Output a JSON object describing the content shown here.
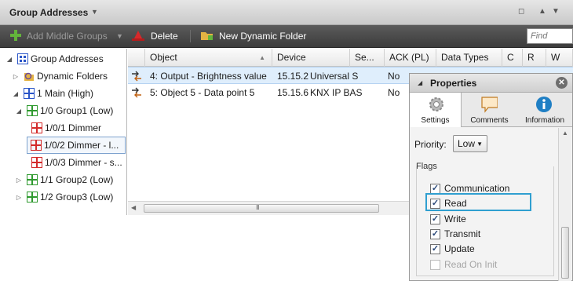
{
  "window": {
    "title": "Group Addresses",
    "title_arrow": "▼",
    "restore_glyph": "◻",
    "up_glyph": "▲",
    "down_glyph": "▼"
  },
  "toolbar": {
    "add_middle_groups": "Add Middle Groups",
    "delete": "Delete",
    "new_dynamic_folder": "New Dynamic Folder",
    "find_placeholder": "Find"
  },
  "tree": {
    "items": [
      {
        "label": "Group Addresses",
        "expander": "◢",
        "icon": "group-addresses-icon"
      },
      {
        "label": "Dynamic Folders",
        "expander": "▷",
        "icon": "dynamic-folder-icon"
      },
      {
        "label": "1 Main (High)",
        "expander": "◢",
        "icon": "main-group-icon"
      },
      {
        "label": "1/0 Group1 (Low)",
        "expander": "◢",
        "icon": "middle-group-icon"
      },
      {
        "label": "1/0/1 Dimmer",
        "expander": "",
        "icon": "group-address-icon"
      },
      {
        "label": "1/0/2 Dimmer - l...",
        "expander": "",
        "icon": "group-address-icon"
      },
      {
        "label": "1/0/3 Dimmer - s...",
        "expander": "",
        "icon": "group-address-icon"
      },
      {
        "label": "1/1 Group2 (Low)",
        "expander": "▷",
        "icon": "middle-group-icon"
      },
      {
        "label": "1/2 Group3 (Low)",
        "expander": "▷",
        "icon": "middle-group-icon"
      }
    ]
  },
  "grid": {
    "columns": [
      "Object",
      "Device",
      "Se...",
      "ACK (PL)",
      "Data Types",
      "C",
      "R",
      "W"
    ],
    "sort_indicator": "▲",
    "rows": [
      {
        "object": "4: Output - Brightness value",
        "device": "15.15.2",
        "device_name": "Universal S",
        "ack": "No"
      },
      {
        "object": "5: Object 5 - Data point 5",
        "device": "15.15.6",
        "device_name": "KNX IP BAS",
        "ack": "No"
      }
    ],
    "hscroll_grip": "III"
  },
  "properties": {
    "title": "Properties",
    "close_glyph": "✕",
    "tabs": [
      {
        "label": "Settings",
        "icon": "gear-icon"
      },
      {
        "label": "Comments",
        "icon": "comment-icon"
      },
      {
        "label": "Information",
        "icon": "info-icon"
      }
    ],
    "priority_label": "Priority:",
    "priority_value": "Low",
    "flags_label": "Flags",
    "flags": [
      {
        "label": "Communication",
        "checked": true,
        "enabled": true
      },
      {
        "label": "Read",
        "checked": true,
        "enabled": true
      },
      {
        "label": "Write",
        "checked": true,
        "enabled": true
      },
      {
        "label": "Transmit",
        "checked": true,
        "enabled": true
      },
      {
        "label": "Update",
        "checked": true,
        "enabled": true
      },
      {
        "label": "Read On Init",
        "checked": false,
        "enabled": false
      }
    ],
    "check_glyph": "✓"
  },
  "colors": {
    "toolbar_bg": "#4a4a4a",
    "selection_bg": "#dfeefc",
    "highlight_border": "#2f9fd0",
    "group_address_red": "#d32a2a",
    "middle_group_green": "#2f9a2f",
    "main_group_blue": "#2a55c8"
  }
}
